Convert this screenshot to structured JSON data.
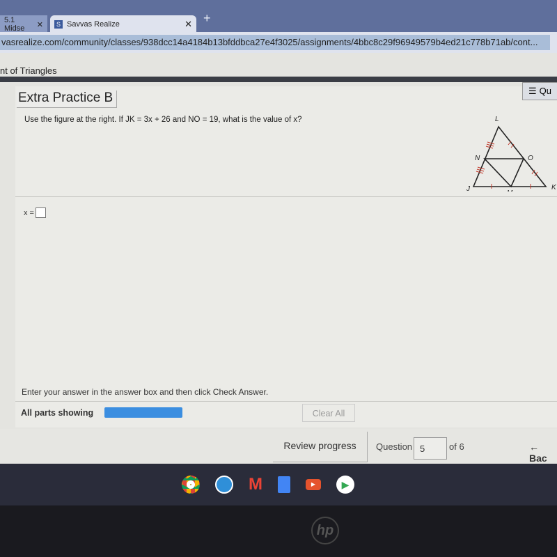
{
  "browser": {
    "tabs": [
      {
        "label": "5.1 Midse"
      },
      {
        "label": "Savvas Realize",
        "icon": "savvas-logo-icon"
      }
    ],
    "url": "vasrealize.com/community/classes/938dcc14a4184b13bfddbca27e4f3025/assignments/4bbc8c29f96949579b4ed21c778b71ab/cont..."
  },
  "breadcrumb": "nt of Triangles",
  "card": {
    "title": "Extra Practice B",
    "questions_button": "Qu",
    "question": "Use the figure at the right. If JK = 3x + 26 and NO = 19, what is the value of x?",
    "figure_labels": {
      "L": "L",
      "N": "N",
      "O": "O",
      "J": "J",
      "M": "M",
      "K": "K"
    },
    "answer_prefix": "x =",
    "answer_value": "",
    "instruction": "Enter your answer in the answer box and then click Check Answer.",
    "parts_label": "All parts showing",
    "clear_all": "Clear All",
    "accent": "#3b8ee0"
  },
  "footer": {
    "review": "Review progress",
    "question_label": "Question",
    "question_number": "5",
    "of_label": "of 6",
    "back": "← Bac"
  },
  "shelf": [
    "chrome",
    "meet",
    "gmail",
    "docs",
    "youtube",
    "play-store"
  ],
  "logo": "hp"
}
